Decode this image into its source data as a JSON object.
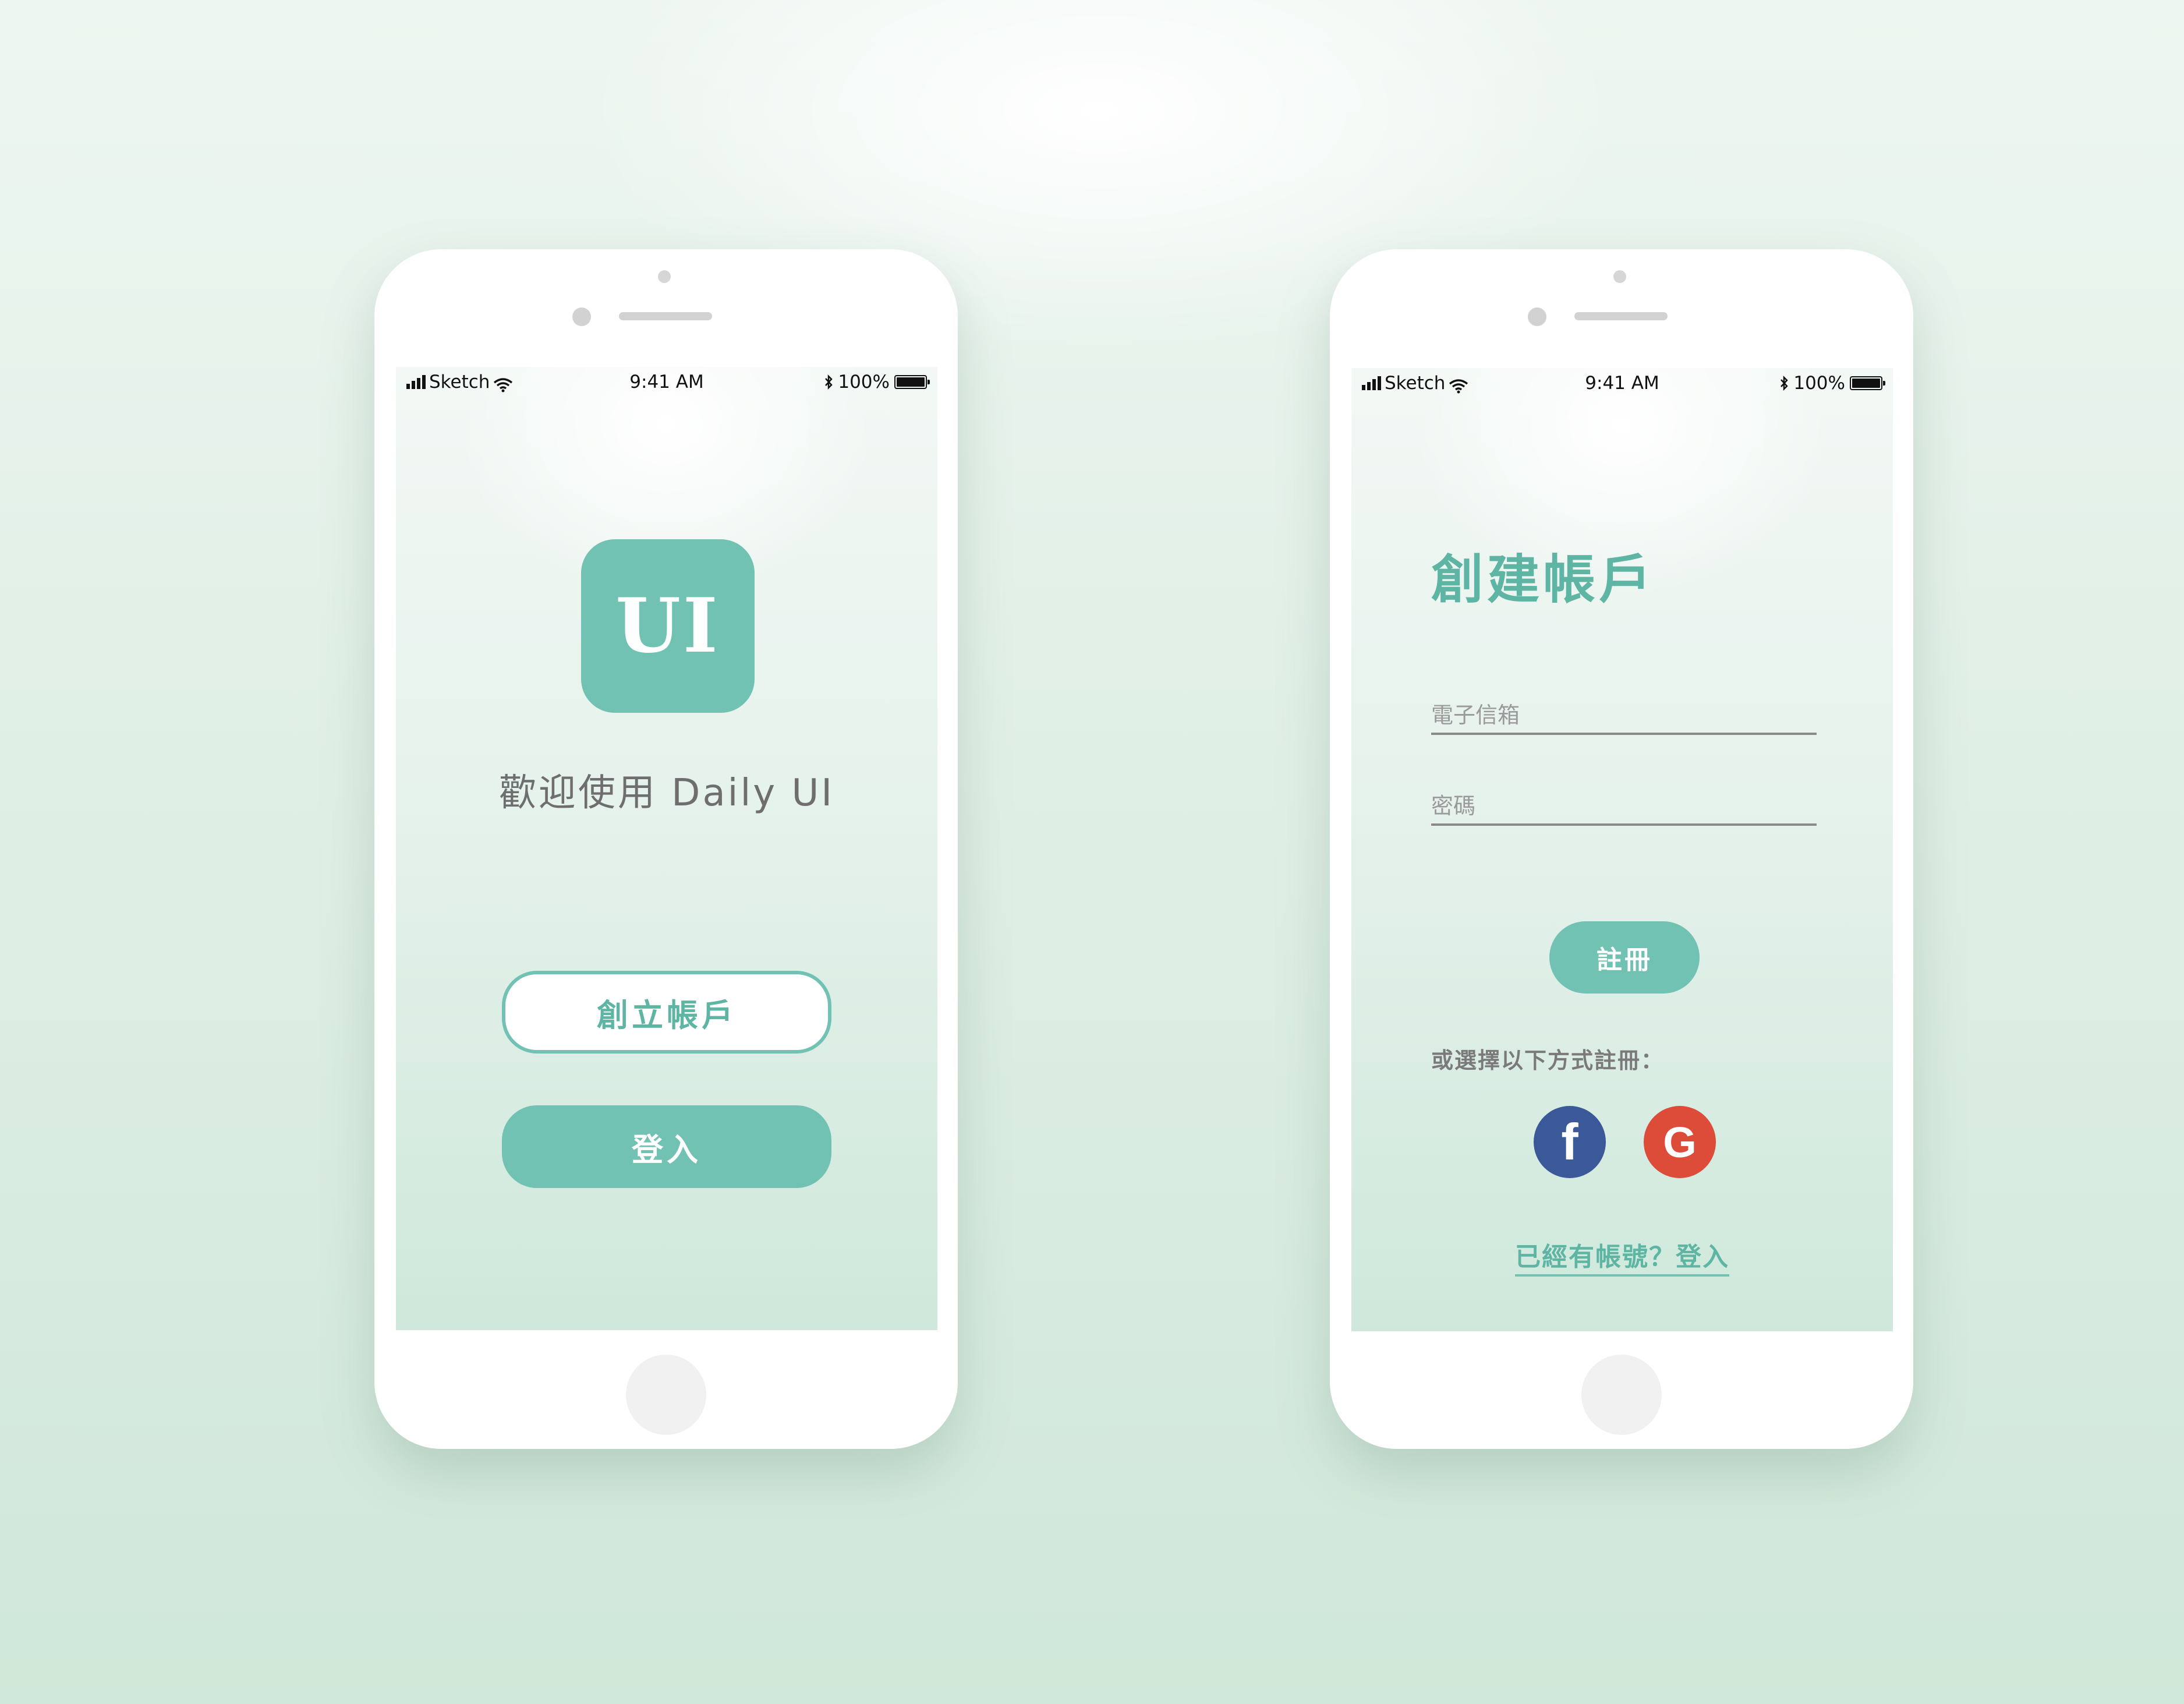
{
  "status_bar": {
    "carrier": "Sketch",
    "time": "9:41 AM",
    "battery": "100%"
  },
  "welcome_screen": {
    "app_icon_text": "UI",
    "welcome_text": "歡迎使用 Daily UI",
    "create_account_label": "創立帳戶",
    "login_label": "登入"
  },
  "register_screen": {
    "title": "創建帳戶",
    "email_placeholder": "電子信箱",
    "password_placeholder": "密碼",
    "register_label": "註冊",
    "alt_register_text": "或選擇以下方式註冊：",
    "facebook_letter": "f",
    "google_letter": "G",
    "login_link": "已經有帳號？登入"
  },
  "colors": {
    "accent": "#72c2b3",
    "facebook": "#3b5998",
    "google": "#dd4b39"
  }
}
